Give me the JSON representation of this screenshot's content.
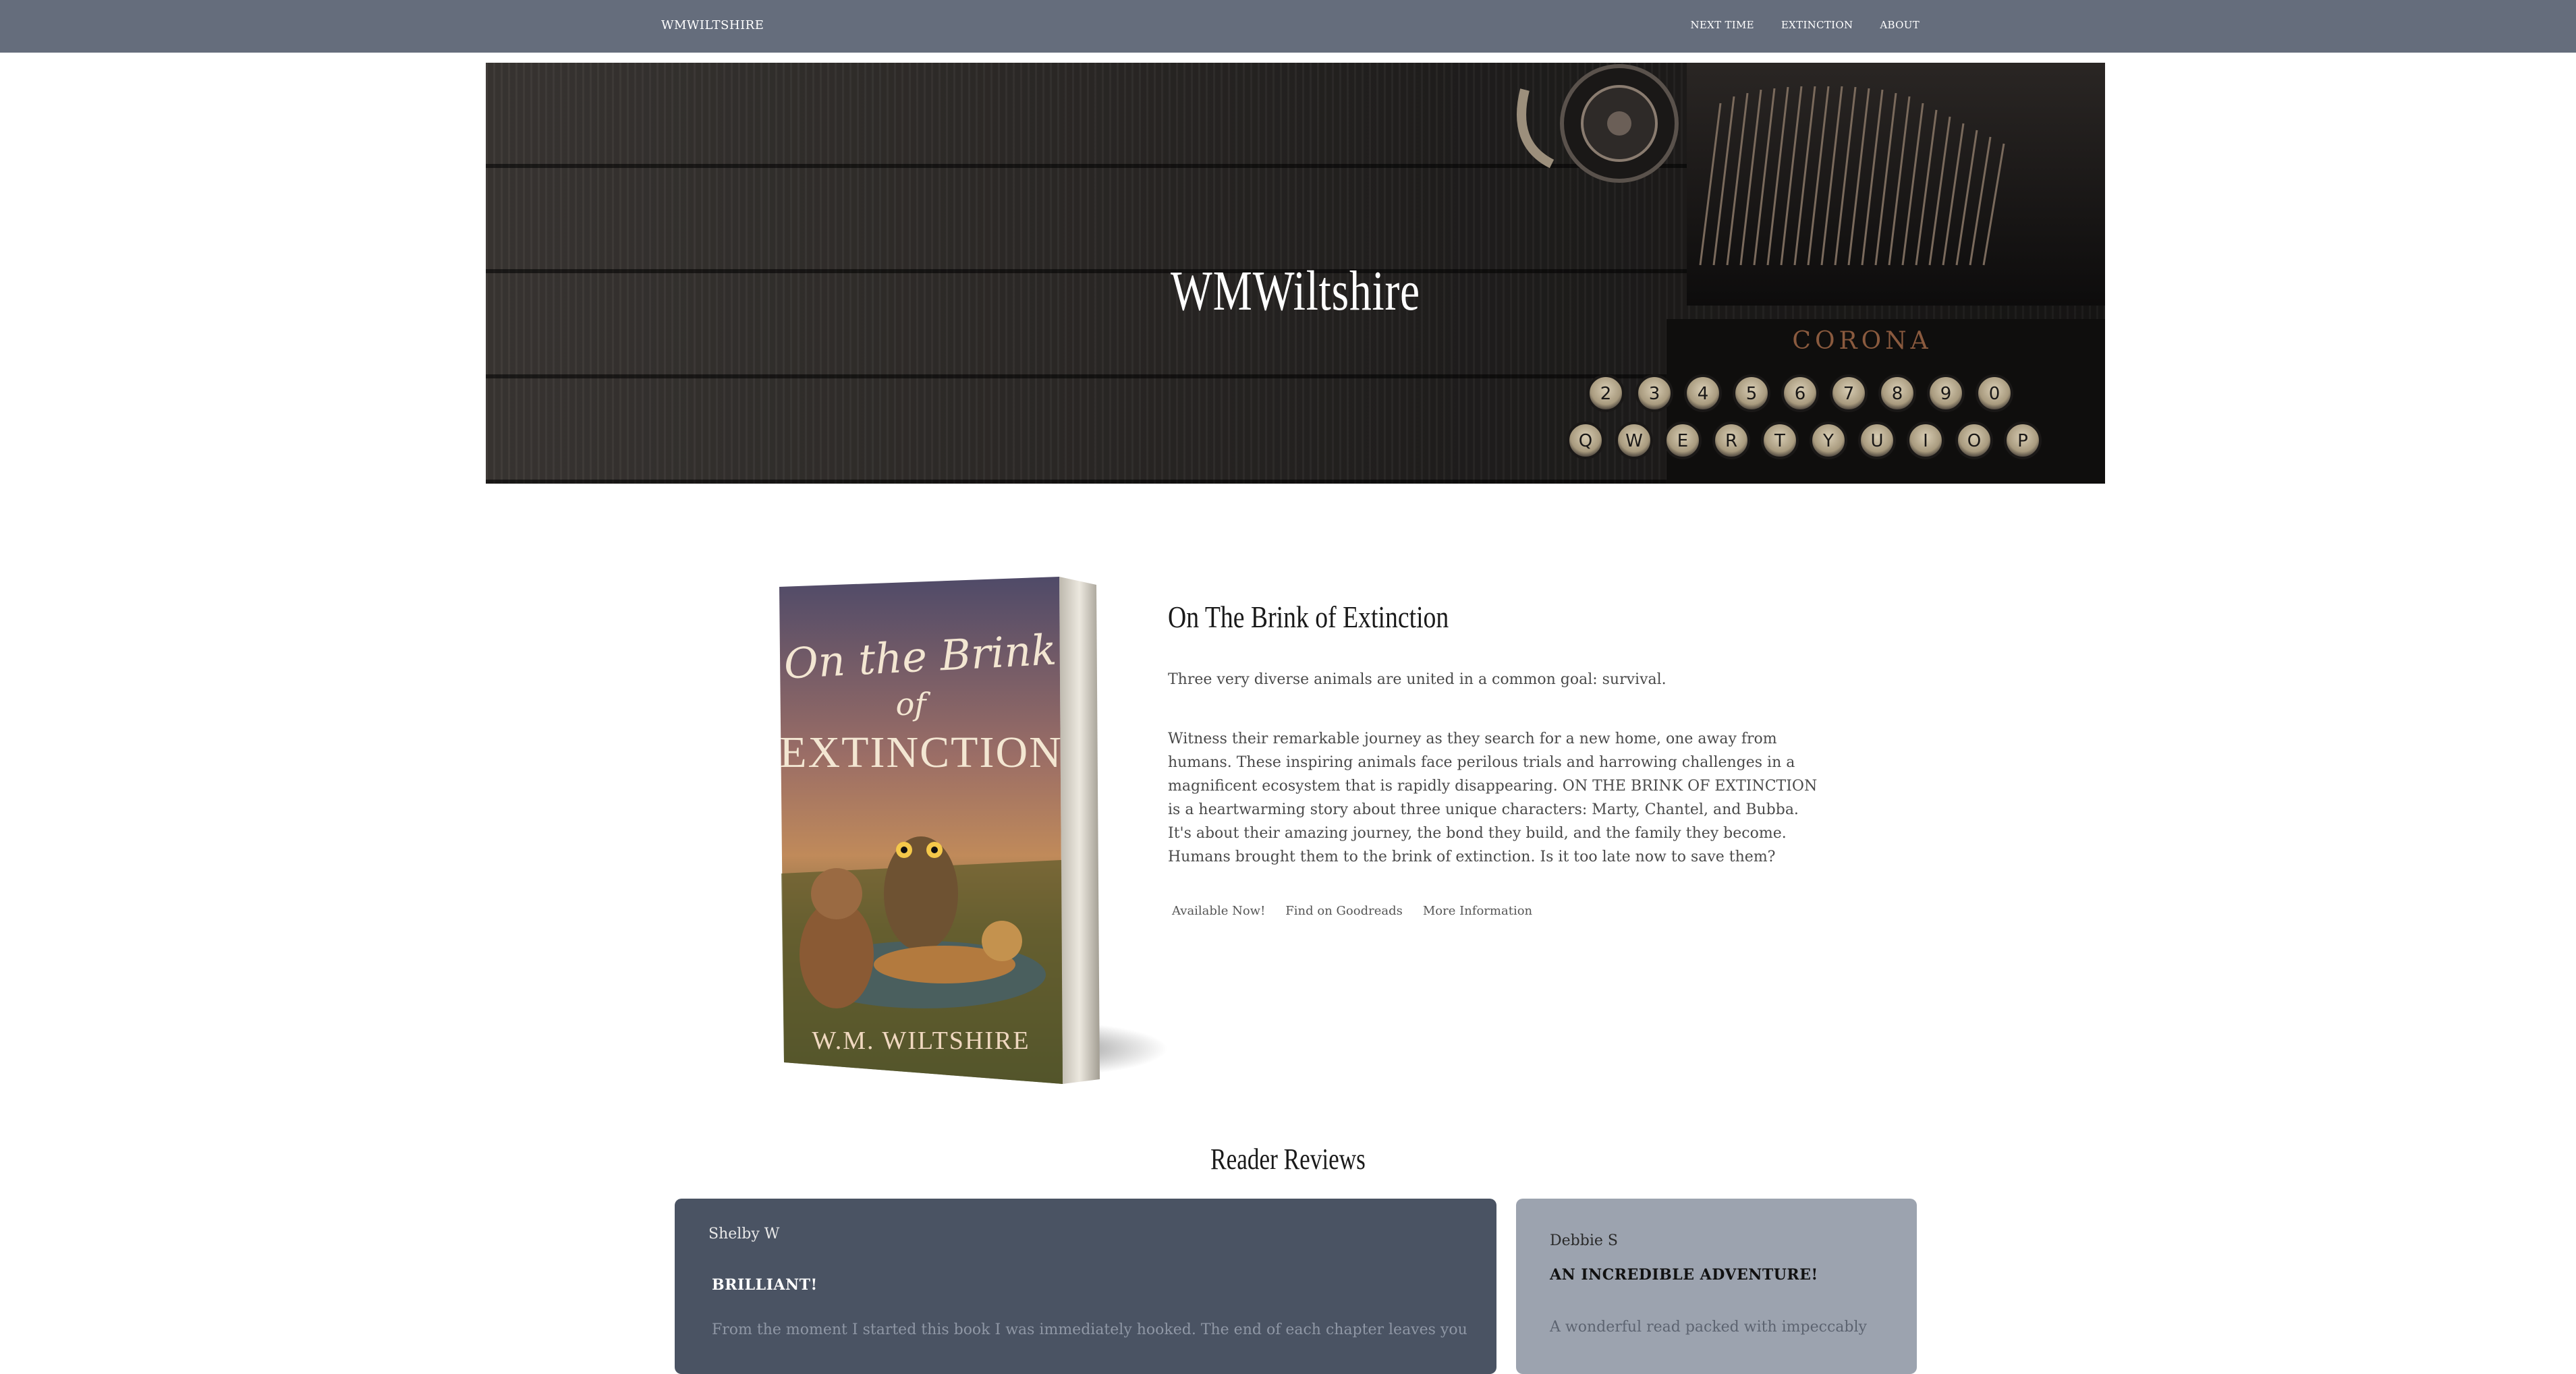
{
  "navbar": {
    "brand": "WMWILTSHIRE",
    "links": [
      {
        "label": "NEXT TIME"
      },
      {
        "label": "EXTINCTION"
      },
      {
        "label": "ABOUT"
      }
    ]
  },
  "hero": {
    "title": "WMWiltshire",
    "typewriter_brand": "CORONA",
    "keys_top": [
      "2",
      "3",
      "4",
      "5",
      "6",
      "7",
      "8",
      "9",
      "0"
    ],
    "keys_row": [
      "Q",
      "W",
      "E",
      "R",
      "T",
      "Y",
      "U",
      "I",
      "O",
      "P"
    ]
  },
  "book": {
    "cover_title_line1": "On the Brink",
    "cover_title_line2": "of",
    "cover_title_line3": "EXTINCTION",
    "cover_author": "W.M. WILTSHIRE",
    "title": "On The Brink of Extinction",
    "tagline": "Three very diverse animals are united in a common goal: survival.",
    "description": "Witness their remarkable journey as they search for a new home, one away from humans. These inspiring animals face perilous trials and harrowing challenges in a magnificent ecosystem that is rapidly disappearing. ON THE BRINK OF EXTINCTION is a heartwarming story about three unique characters: Marty, Chantel, and Bubba. It's about their amazing journey, the bond they build, and the family they become. Humans brought them to the brink of extinction. Is it too late now to save them?",
    "links": {
      "available": "Available Now!",
      "goodreads": "Find on Goodreads",
      "more_info": "More Information"
    }
  },
  "reviews": {
    "heading": "Reader Reviews",
    "items": [
      {
        "name": "Shelby W",
        "title": "BRILLIANT!",
        "text": "From the moment I started this book I was immediately hooked. The end of each chapter leaves you"
      },
      {
        "name": "Debbie S",
        "title": "AN INCREDIBLE ADVENTURE!",
        "text": "A wonderful read packed with impeccably"
      }
    ]
  },
  "colors": {
    "navbar_bg": "#656d7c",
    "review_dark_bg": "#4a5363",
    "review_light_bg": "#9ca3af"
  }
}
